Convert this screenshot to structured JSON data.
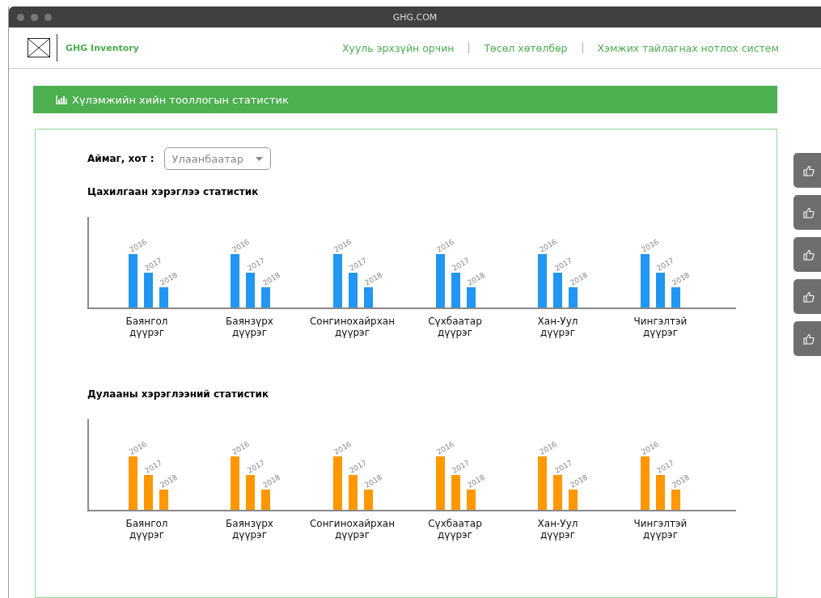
{
  "window": {
    "title": "GHG.COM"
  },
  "header": {
    "brand": "GHG Inventory",
    "nav": [
      {
        "label": "Хууль эрхзүйн орчин"
      },
      {
        "label": "Төсөл хөтөлбөр"
      },
      {
        "label": "Хэмжих тайлагнах нотлох систем"
      }
    ]
  },
  "banner": {
    "title": "Хүлэмжийн хийн тооллогын статистик"
  },
  "filter": {
    "label": "Аймаг, хот :",
    "value": "Улаанбаатар"
  },
  "charts": [
    {
      "title": "Цахилгаан хэрэглээ статистик",
      "color": "#2196f3",
      "groups": [
        {
          "label": "Баянгол дүүрэг",
          "bars": [
            "2016",
            "2017",
            "2018"
          ]
        },
        {
          "label": "Баянзүрх дүүрэг",
          "bars": [
            "2016",
            "2017",
            "2018"
          ]
        },
        {
          "label": "Сонгинохайрхан дүүрэг",
          "bars": [
            "2016",
            "2017",
            "2018"
          ]
        },
        {
          "label": "Сүхбаатар дүүрэг",
          "bars": [
            "2016",
            "2017",
            "2018"
          ]
        },
        {
          "label": "Хан-Уул дүүрэг",
          "bars": [
            "2016",
            "2017",
            "2018"
          ]
        },
        {
          "label": "Чингэлтэй дүүрэг",
          "bars": [
            "2016",
            "2017",
            "2018"
          ]
        }
      ]
    },
    {
      "title": "Дулааны хэрэглээний статистик",
      "color": "#ff9800",
      "groups": [
        {
          "label": "Баянгол дүүрэг",
          "bars": [
            "2016",
            "2017",
            "2018"
          ]
        },
        {
          "label": "Баянзүрх дүүрэг",
          "bars": [
            "2016",
            "2017",
            "2018"
          ]
        },
        {
          "label": "Сонгинохайрхан дүүрэг",
          "bars": [
            "2016",
            "2017",
            "2018"
          ]
        },
        {
          "label": "Сүхбаатар дүүрэг",
          "bars": [
            "2016",
            "2017",
            "2018"
          ]
        },
        {
          "label": "Хан-Уул дүүрэг",
          "bars": [
            "2016",
            "2017",
            "2018"
          ]
        },
        {
          "label": "Чингэлтэй дүүрэг",
          "bars": [
            "2016",
            "2017",
            "2018"
          ]
        }
      ]
    }
  ],
  "side_buttons": [
    {
      "kind": "like"
    },
    {
      "kind": "like"
    },
    {
      "kind": "like"
    },
    {
      "kind": "like"
    },
    {
      "kind": "like"
    }
  ]
}
